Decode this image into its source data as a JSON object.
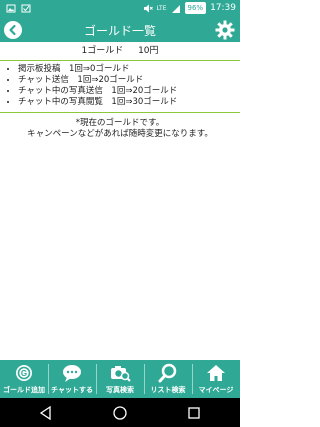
{
  "status_bar": {
    "lte": "LTE",
    "battery": "96%",
    "time": "17:39"
  },
  "header": {
    "title": "ゴールド一覧",
    "back_glyph": "◀",
    "settings_icon": "gear-icon"
  },
  "rate": {
    "gold": "1ゴールド",
    "yen": "10円"
  },
  "items": [
    "掲示板投稿　1回⇒0ゴールド",
    "チャット送信　1回⇒20ゴールド",
    "チャット中の写真送信　1回⇒20ゴールド",
    "チャット中の写真閲覧　1回⇒30ゴールド"
  ],
  "notice": {
    "line1": "*現在のゴールドです。",
    "line2": "キャンペーンなどがあれば随時変更になります。"
  },
  "bottom_nav": [
    {
      "label": "ゴールド追加",
      "icon": "gold-coin-icon"
    },
    {
      "label": "チャットする",
      "icon": "chat-bubble-icon"
    },
    {
      "label": "写真検索",
      "icon": "camera-search-icon"
    },
    {
      "label": "リスト検索",
      "icon": "magnifier-icon"
    },
    {
      "label": "マイページ",
      "icon": "home-icon"
    }
  ],
  "colors": {
    "primary": "#2fa996",
    "divider": "#8cc63f"
  }
}
